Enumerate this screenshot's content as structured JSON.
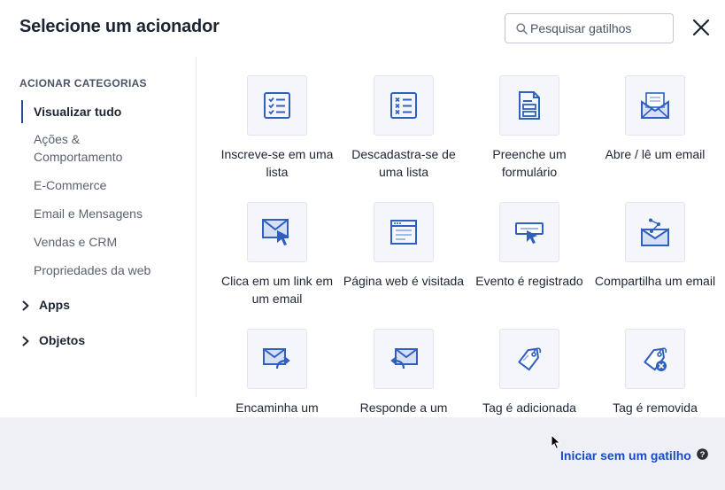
{
  "header": {
    "title": "Selecione um acionador",
    "search_placeholder": "Pesquisar gatilhos"
  },
  "sidebar": {
    "heading": "ACIONAR CATEGORIAS",
    "items": [
      {
        "label": "Visualizar tudo",
        "active": true
      },
      {
        "label": "Ações & Comportamento",
        "active": false
      },
      {
        "label": "E-Commerce",
        "active": false
      },
      {
        "label": "Email e Mensagens",
        "active": false
      },
      {
        "label": "Vendas e CRM",
        "active": false
      },
      {
        "label": "Propriedades da web",
        "active": false
      }
    ],
    "groups": [
      {
        "label": "Apps",
        "icon": "chevron-right-icon"
      },
      {
        "label": "Objetos",
        "icon": "chevron-right-icon"
      }
    ]
  },
  "triggers": [
    {
      "label": "Inscreve-se em uma lista",
      "icon": "subscribe-list-icon"
    },
    {
      "label": "Descadastra-se de uma lista",
      "icon": "unsubscribe-list-icon"
    },
    {
      "label": "Preenche um formulário",
      "icon": "form-icon"
    },
    {
      "label": "Abre / lê um email",
      "icon": "open-email-icon"
    },
    {
      "label": "Clica em um link em um email",
      "icon": "click-email-link-icon"
    },
    {
      "label": "Página web é visitada",
      "icon": "web-page-icon"
    },
    {
      "label": "Evento é registrado",
      "icon": "event-icon"
    },
    {
      "label": "Compartilha um email",
      "icon": "share-email-icon"
    },
    {
      "label": "Encaminha um",
      "icon": "forward-email-icon"
    },
    {
      "label": "Responde a um",
      "icon": "reply-email-icon"
    },
    {
      "label": "Tag é adicionada",
      "icon": "tag-added-icon"
    },
    {
      "label": "Tag é removida",
      "icon": "tag-removed-icon"
    }
  ],
  "footer": {
    "start_link": "Iniciar sem um gatilho",
    "help_icon": "question-circle-icon"
  },
  "colors": {
    "accent": "#1b4bc4",
    "icon_blue": "#2f5fbf",
    "icon_light": "#9db8ea",
    "footer_bg": "#eef0f5"
  }
}
